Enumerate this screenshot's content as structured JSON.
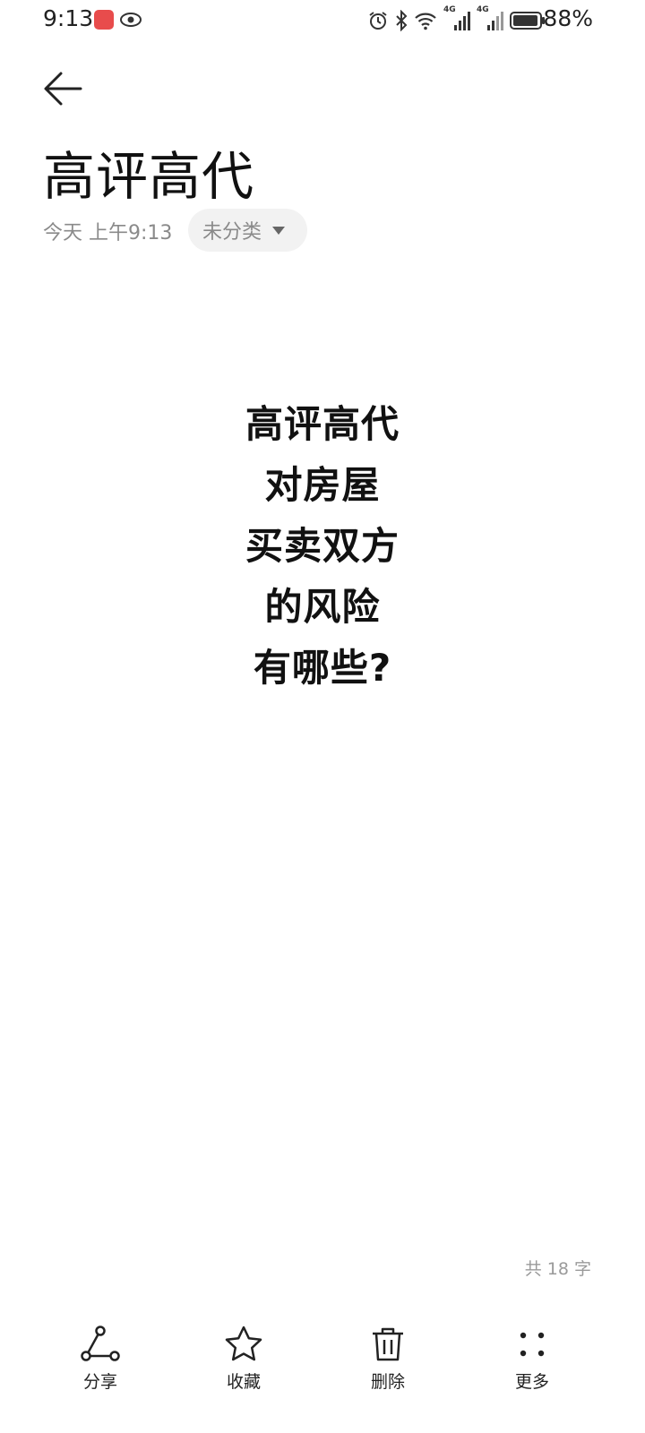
{
  "status_bar": {
    "time": "9:13",
    "battery": "88%",
    "network_1": "4G",
    "network_2": "4G",
    "icons": [
      "app-notification-icon",
      "eye-icon",
      "alarm-icon",
      "bluetooth-icon",
      "wifi-icon",
      "signal-icon",
      "signal-icon",
      "battery-icon"
    ]
  },
  "header": {
    "back_icon": "arrow-left-icon",
    "title": "高评高代",
    "timestamp": "今天 上午9:13",
    "category": "未分类"
  },
  "note": {
    "lines": [
      "高评高代",
      "对房屋",
      "买卖双方",
      "的风险",
      "有哪些?"
    ]
  },
  "word_count": "共 18 字",
  "bottom_bar": {
    "items": [
      {
        "label": "分享",
        "icon": "share-icon"
      },
      {
        "label": "收藏",
        "icon": "star-icon"
      },
      {
        "label": "删除",
        "icon": "trash-icon"
      },
      {
        "label": "更多",
        "icon": "more-icon"
      }
    ]
  },
  "colors": {
    "background": "#ffffff",
    "text_primary": "#111111",
    "text_secondary": "#8a8a8a",
    "chip_bg": "#f2f2f2"
  }
}
